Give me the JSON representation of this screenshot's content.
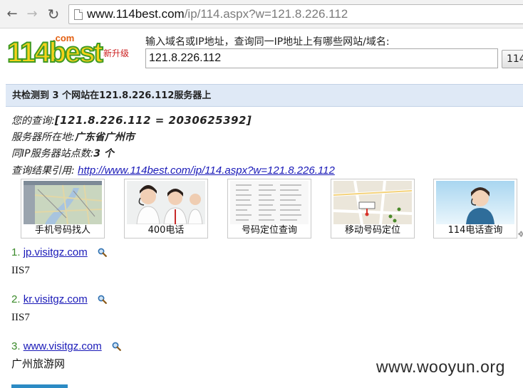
{
  "browser": {
    "url_host": "www.114best.com",
    "url_path": "/ip/114.aspx?w=121.8.226.112"
  },
  "header": {
    "logo_text": "114best",
    "logo_com": ".com",
    "logo_badge": "新升级",
    "query_prompt": "输入域名或IP地址，查询同一IP地址上有哪些网站/域名:",
    "query_value": "121.8.226.112",
    "query_button": "114"
  },
  "summary": {
    "title": "共检测到 3 个网站在121.8.226.112服务器上"
  },
  "info": {
    "query_label": "您的查询:",
    "query_value": "[121.8.226.112 = 2030625392]",
    "location_label": "服务器所在地:",
    "location_value": "广东省广州市",
    "count_label": "同IP服务器站点数:",
    "count_value": "3 个",
    "cite_label": "查询结果引用:",
    "cite_link": "http://www.114best.com/ip/114.aspx?w=121.8.226.112"
  },
  "ads": [
    {
      "caption": "手机号码找人"
    },
    {
      "caption": "400电话"
    },
    {
      "caption": "号码定位查询"
    },
    {
      "caption": "移动号码定位"
    },
    {
      "caption": "114电话查询"
    }
  ],
  "results": [
    {
      "num": "1.",
      "domain": "jp.visitgz.com",
      "server": "IIS7"
    },
    {
      "num": "2.",
      "domain": "kr.visitgz.com",
      "server": "IIS7"
    },
    {
      "num": "3.",
      "domain": "www.visitgz.com",
      "server": "广州旅游网"
    }
  ],
  "watermark": "www.wooyun.org",
  "colors": {
    "link": "#1a1ab8",
    "result_number": "#3a8a2a",
    "summary_bar": "#dfe9f6",
    "logo_green": "#3f9a22",
    "logo_yellow": "#f6d21a"
  },
  "icons": [
    "back-arrow-icon",
    "forward-arrow-icon",
    "reload-icon",
    "page-icon",
    "magnifier-icon"
  ]
}
